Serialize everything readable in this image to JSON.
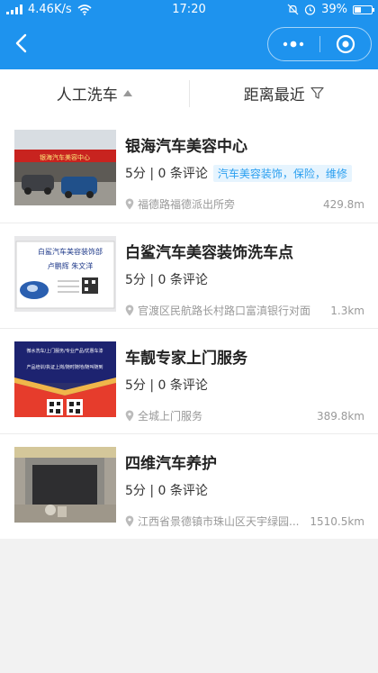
{
  "status_bar": {
    "speed": "4.46K/s",
    "time": "17:20",
    "battery": "39%",
    "battery_level": 0.39
  },
  "header": {
    "back_icon": "chevron-left-icon",
    "more_icon": "more-dots-icon",
    "close_icon": "target-circle-icon"
  },
  "filters": {
    "category": "人工洗车",
    "sort": "距离最近"
  },
  "shops": [
    {
      "name": "银海汽车美容中心",
      "rating": "5分 | 0 条评论",
      "tag": "汽车美容装饰，保险，维修",
      "address": "福德路福德派出所旁",
      "distance": "429.8m",
      "sign_text": "银海汽车美容中心"
    },
    {
      "name": "白鲨汽车美容装饰洗车点",
      "rating": "5分 | 0 条评论",
      "tag": "",
      "address": "官渡区民航路长村路口富滇银行对面",
      "distance": "1.3km",
      "sign_text": "白鲨汽车美容装饰部",
      "card_name": "卢鹏辉 朱文洋"
    },
    {
      "name": "车靓专家上门服务",
      "rating": "5分 | 0 条评论",
      "tag": "",
      "address": "全城上门服务",
      "distance": "389.8km",
      "banner_lines": [
        "微水洗车/上门服务/专业产品/优惠车漆",
        "产品培训/执证上岗/随时随地/随叫随到"
      ]
    },
    {
      "name": "四维汽车养护",
      "rating": "5分 | 0 条评论",
      "tag": "",
      "address": "江西省景德镇市珠山区天宇绿园...",
      "distance": "1510.5km"
    }
  ],
  "colors": {
    "header_blue": "#1e93ee",
    "tag_blue": "#2a9ff0",
    "tag_bg": "#e6f4fe",
    "text_gray": "#999999"
  }
}
